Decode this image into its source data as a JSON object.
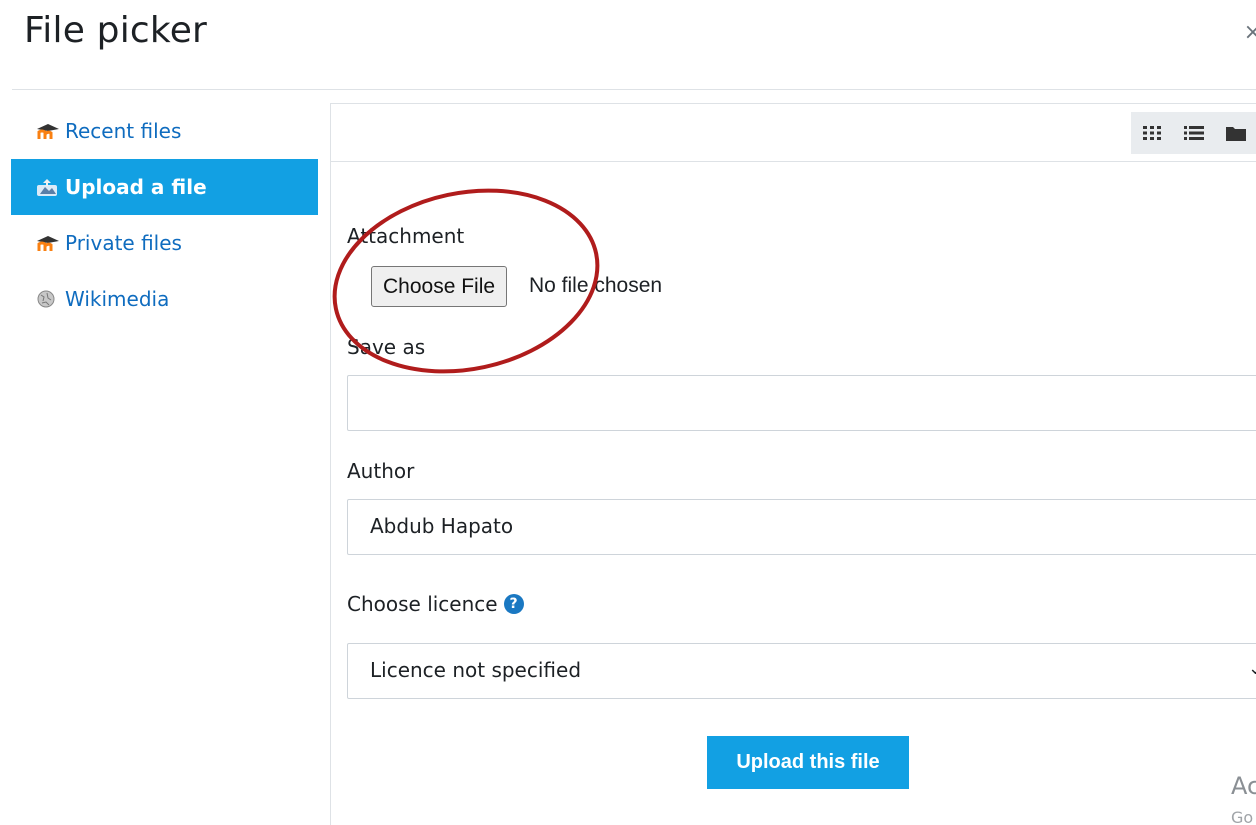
{
  "window": {
    "title": "File picker",
    "close_label": "×"
  },
  "sidebar": {
    "items": [
      {
        "label": "Recent files",
        "icon": "moodle-icon",
        "active": false
      },
      {
        "label": "Upload a file",
        "icon": "upload-icon",
        "active": true
      },
      {
        "label": "Private files",
        "icon": "moodle-icon",
        "active": false
      },
      {
        "label": "Wikimedia",
        "icon": "wikimedia-icon",
        "active": false
      }
    ]
  },
  "toolbar": {
    "views": [
      "grid-view-icon",
      "list-view-icon",
      "folder-view-icon"
    ]
  },
  "form": {
    "attachment_label": "Attachment",
    "choose_file_label": "Choose File",
    "no_file_text": "No file chosen",
    "save_as_label": "Save as",
    "save_as_value": "",
    "author_label": "Author",
    "author_value": "Abdub Hapato",
    "licence_label": "Choose licence",
    "licence_value": "Licence not specified",
    "upload_button": "Upload this file"
  },
  "watermark": {
    "line1": "Ac",
    "line2": "Go"
  },
  "colors": {
    "accent": "#12a0e3",
    "link": "#0f6cbf",
    "annotation": "#b01c1c",
    "help": "#1a78c2"
  }
}
